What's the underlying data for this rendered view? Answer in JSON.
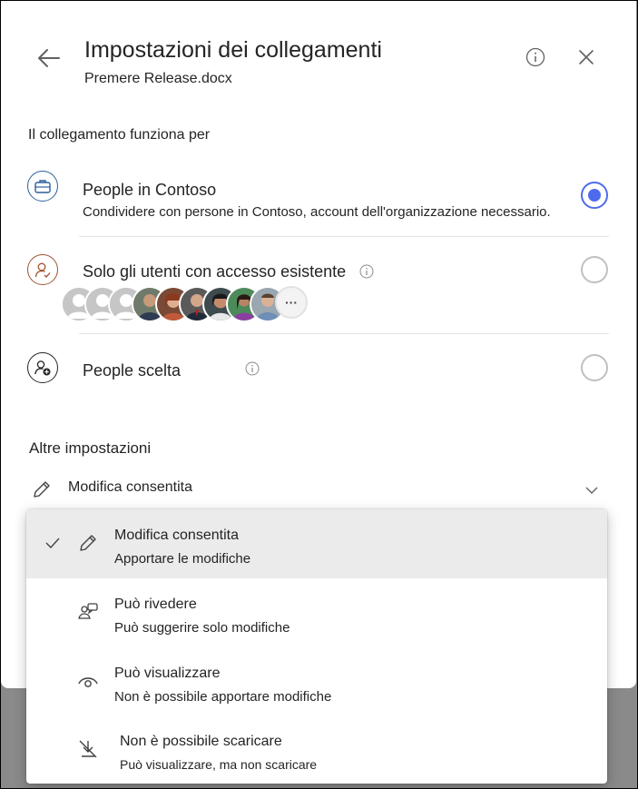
{
  "header": {
    "title": "Impostazioni dei collegamenti",
    "file_name": "Premere Release.docx"
  },
  "link_works_for": {
    "label": "Il collegamento funziona per",
    "options": [
      {
        "title": "People in Contoso",
        "description": "Condividere con persone in Contoso, account dell'organizzazione necessario.",
        "selected": true,
        "icon": "briefcase-icon"
      },
      {
        "title": "Solo gli utenti con accesso esistente",
        "selected": false,
        "icon": "person-check-icon",
        "more_label": "···"
      },
      {
        "title": "People scelta",
        "selected": false,
        "icon": "person-add-icon"
      }
    ]
  },
  "other_settings": {
    "label": "Altre impostazioni",
    "permission_value": "Modifica consentita"
  },
  "permission_menu": {
    "items": [
      {
        "title": "Modifica consentita",
        "description": "Apportare le modifiche",
        "selected": true,
        "icon": "pencil-icon"
      },
      {
        "title": "Può rivedere",
        "description": "Può suggerire solo modifiche",
        "selected": false,
        "icon": "review-icon"
      },
      {
        "title": "Può visualizzare",
        "description": "Non è possibile apportare modifiche",
        "selected": false,
        "icon": "eye-icon"
      },
      {
        "title": "Non è possibile scaricare",
        "description": "Può visualizzare, ma non scaricare",
        "selected": false,
        "icon": "no-download-icon"
      }
    ]
  },
  "colors": {
    "accent": "#4f6bed",
    "briefcase_ring": "#2b5f9e",
    "person_ring": "#a0522d",
    "menu_selected_bg": "#ebebeb"
  }
}
